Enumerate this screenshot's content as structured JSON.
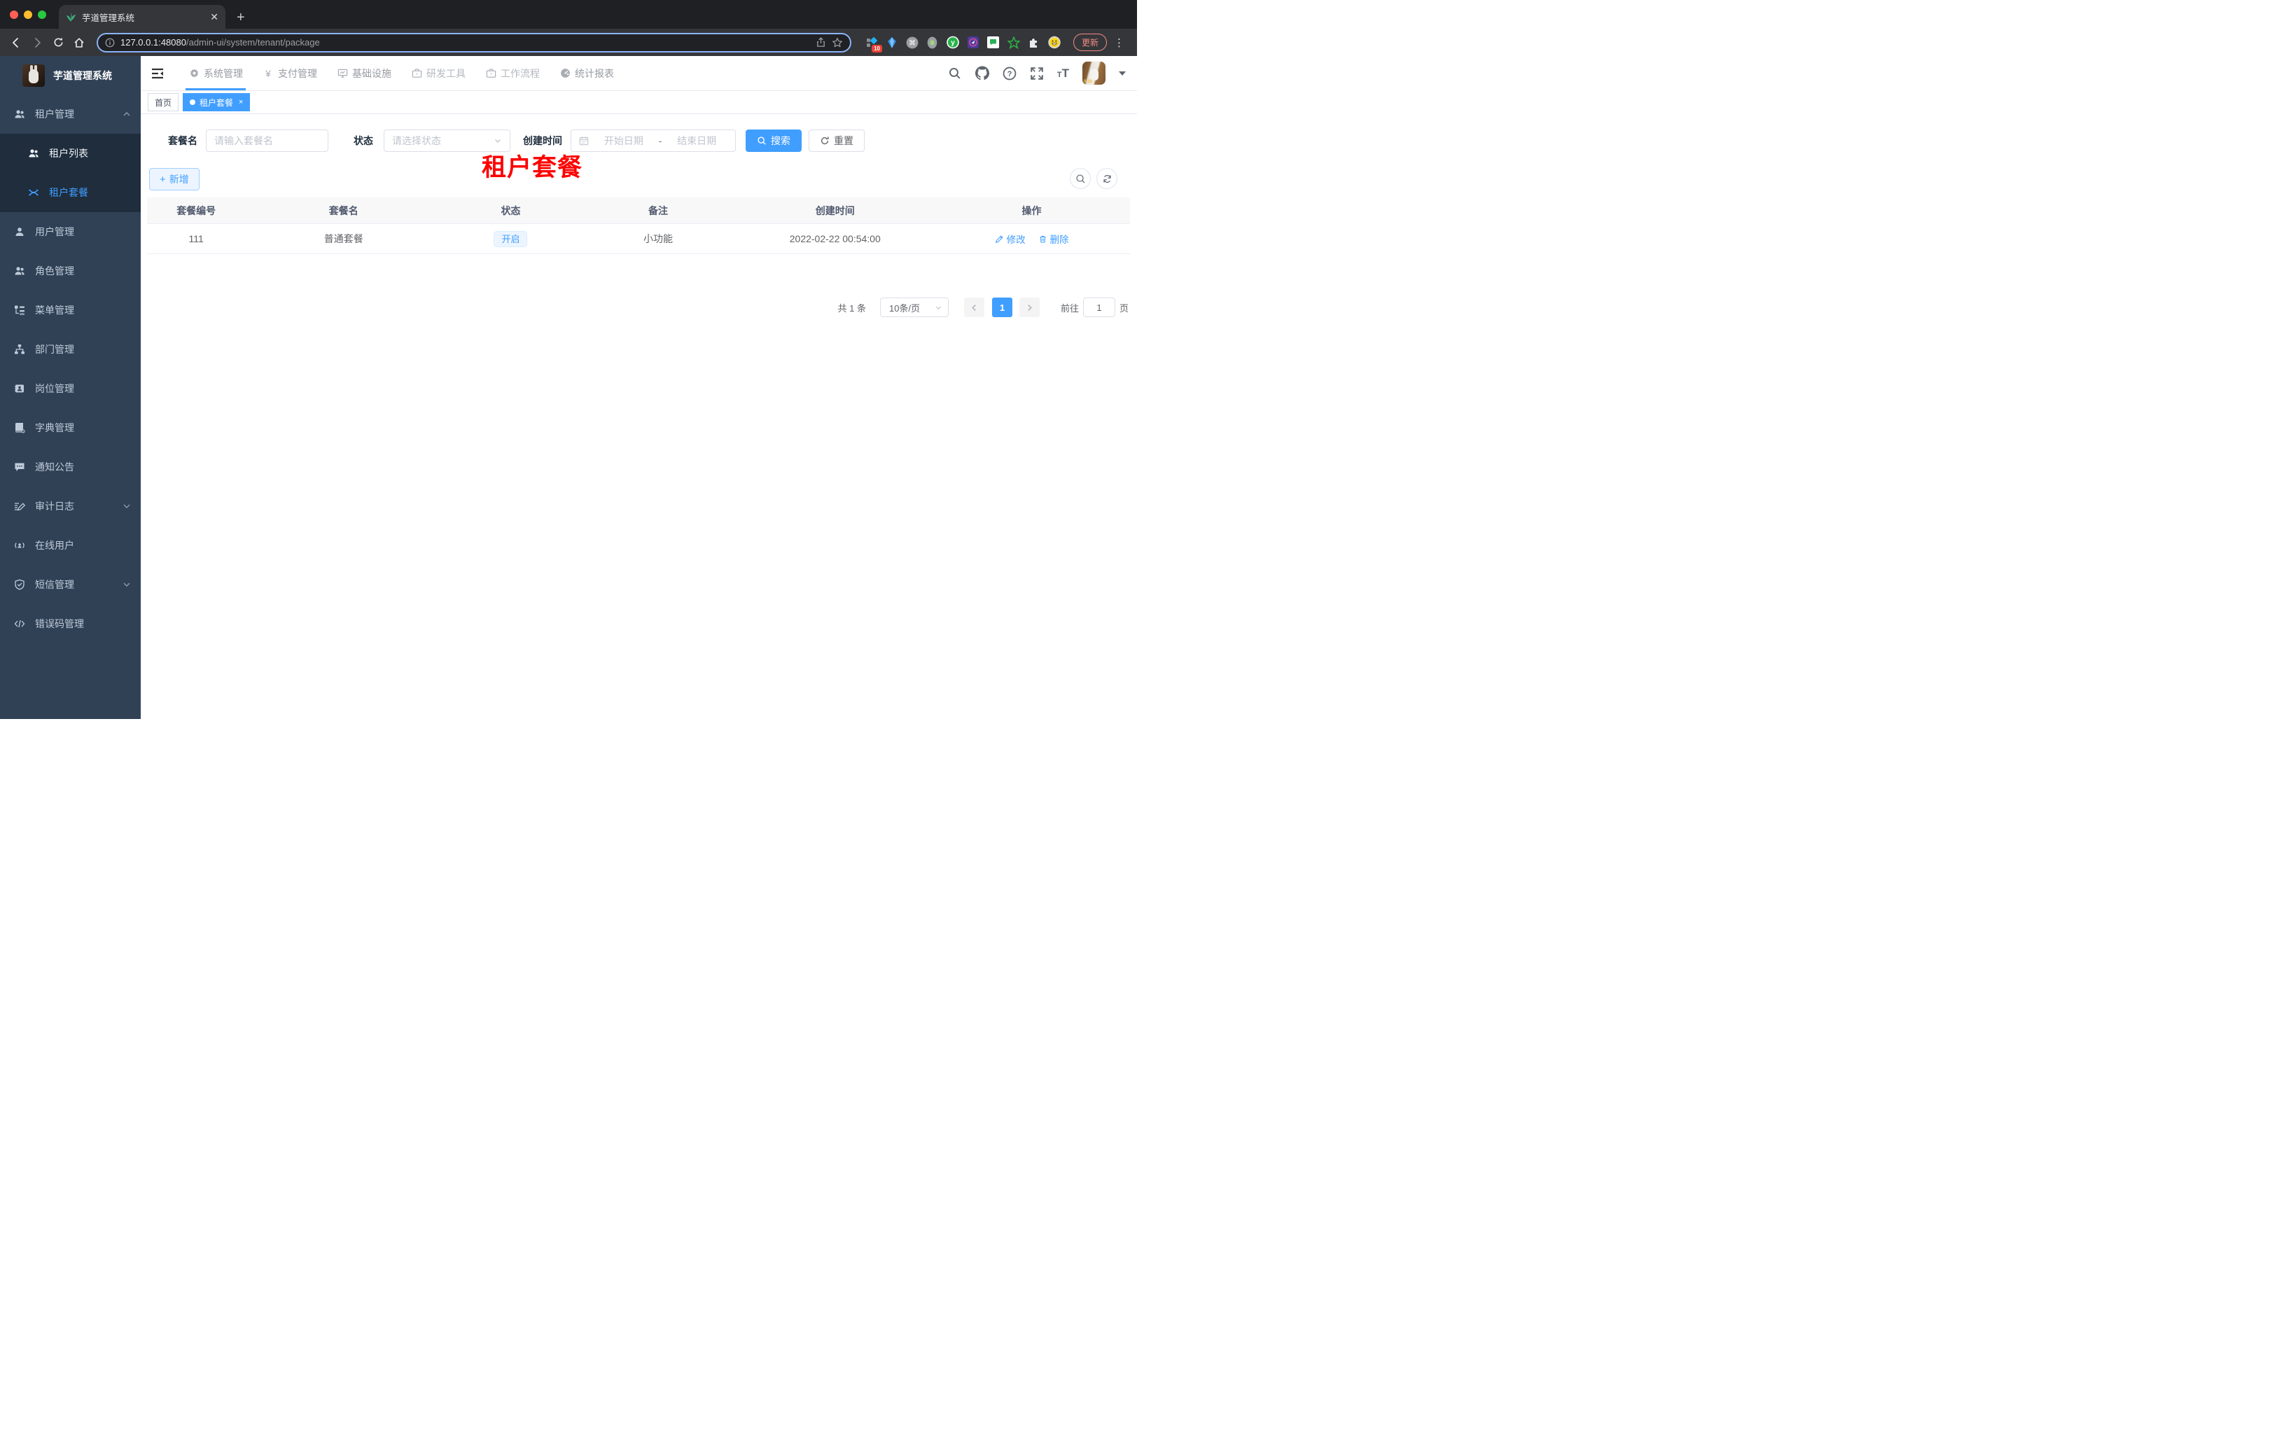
{
  "browser": {
    "tab_title": "芋道管理系统",
    "url_host": "127.0.0.1:48080",
    "url_path": "/admin-ui/system/tenant/package",
    "ext_badge_count": "10",
    "update_label": "更新"
  },
  "app": {
    "logo_title": "芋道管理系统",
    "top_nav": [
      {
        "label": "系统管理"
      },
      {
        "label": "支付管理"
      },
      {
        "label": "基础设施"
      },
      {
        "label": "研发工具"
      },
      {
        "label": "工作流程"
      },
      {
        "label": "统计报表"
      }
    ],
    "sidebar": {
      "items": [
        {
          "label": "租户管理"
        },
        {
          "label": "租户列表"
        },
        {
          "label": "租户套餐"
        },
        {
          "label": "用户管理"
        },
        {
          "label": "角色管理"
        },
        {
          "label": "菜单管理"
        },
        {
          "label": "部门管理"
        },
        {
          "label": "岗位管理"
        },
        {
          "label": "字典管理"
        },
        {
          "label": "通知公告"
        },
        {
          "label": "审计日志"
        },
        {
          "label": "在线用户"
        },
        {
          "label": "短信管理"
        },
        {
          "label": "错误码管理"
        }
      ]
    }
  },
  "tags": {
    "home": "首页",
    "active": "租户套餐"
  },
  "overlay_title": "租户套餐",
  "filters": {
    "name_label": "套餐名",
    "name_placeholder": "请输入套餐名",
    "status_label": "状态",
    "status_placeholder": "请选择状态",
    "date_label": "创建时间",
    "date_start": "开始日期",
    "date_separator": "-",
    "date_end": "结束日期",
    "search_label": "搜索",
    "reset_label": "重置"
  },
  "toolbar": {
    "add_label": "新增"
  },
  "table": {
    "headers": [
      "套餐编号",
      "套餐名",
      "状态",
      "备注",
      "创建时间",
      "操作"
    ],
    "rows": [
      {
        "id": "111",
        "name": "普通套餐",
        "status": "开启",
        "remark": "小功能",
        "created": "2022-02-22 00:54:00",
        "edit": "修改",
        "delete": "删除"
      }
    ]
  },
  "pagination": {
    "total": "共 1 条",
    "page_size": "10条/页",
    "page": "1",
    "goto_label": "前往",
    "goto_value": "1",
    "goto_unit": "页"
  },
  "colors": {
    "primary": "#409eff",
    "sidebar_bg": "#304156",
    "submenu_bg": "#1f2d3d",
    "danger_red": "#fe0000"
  }
}
